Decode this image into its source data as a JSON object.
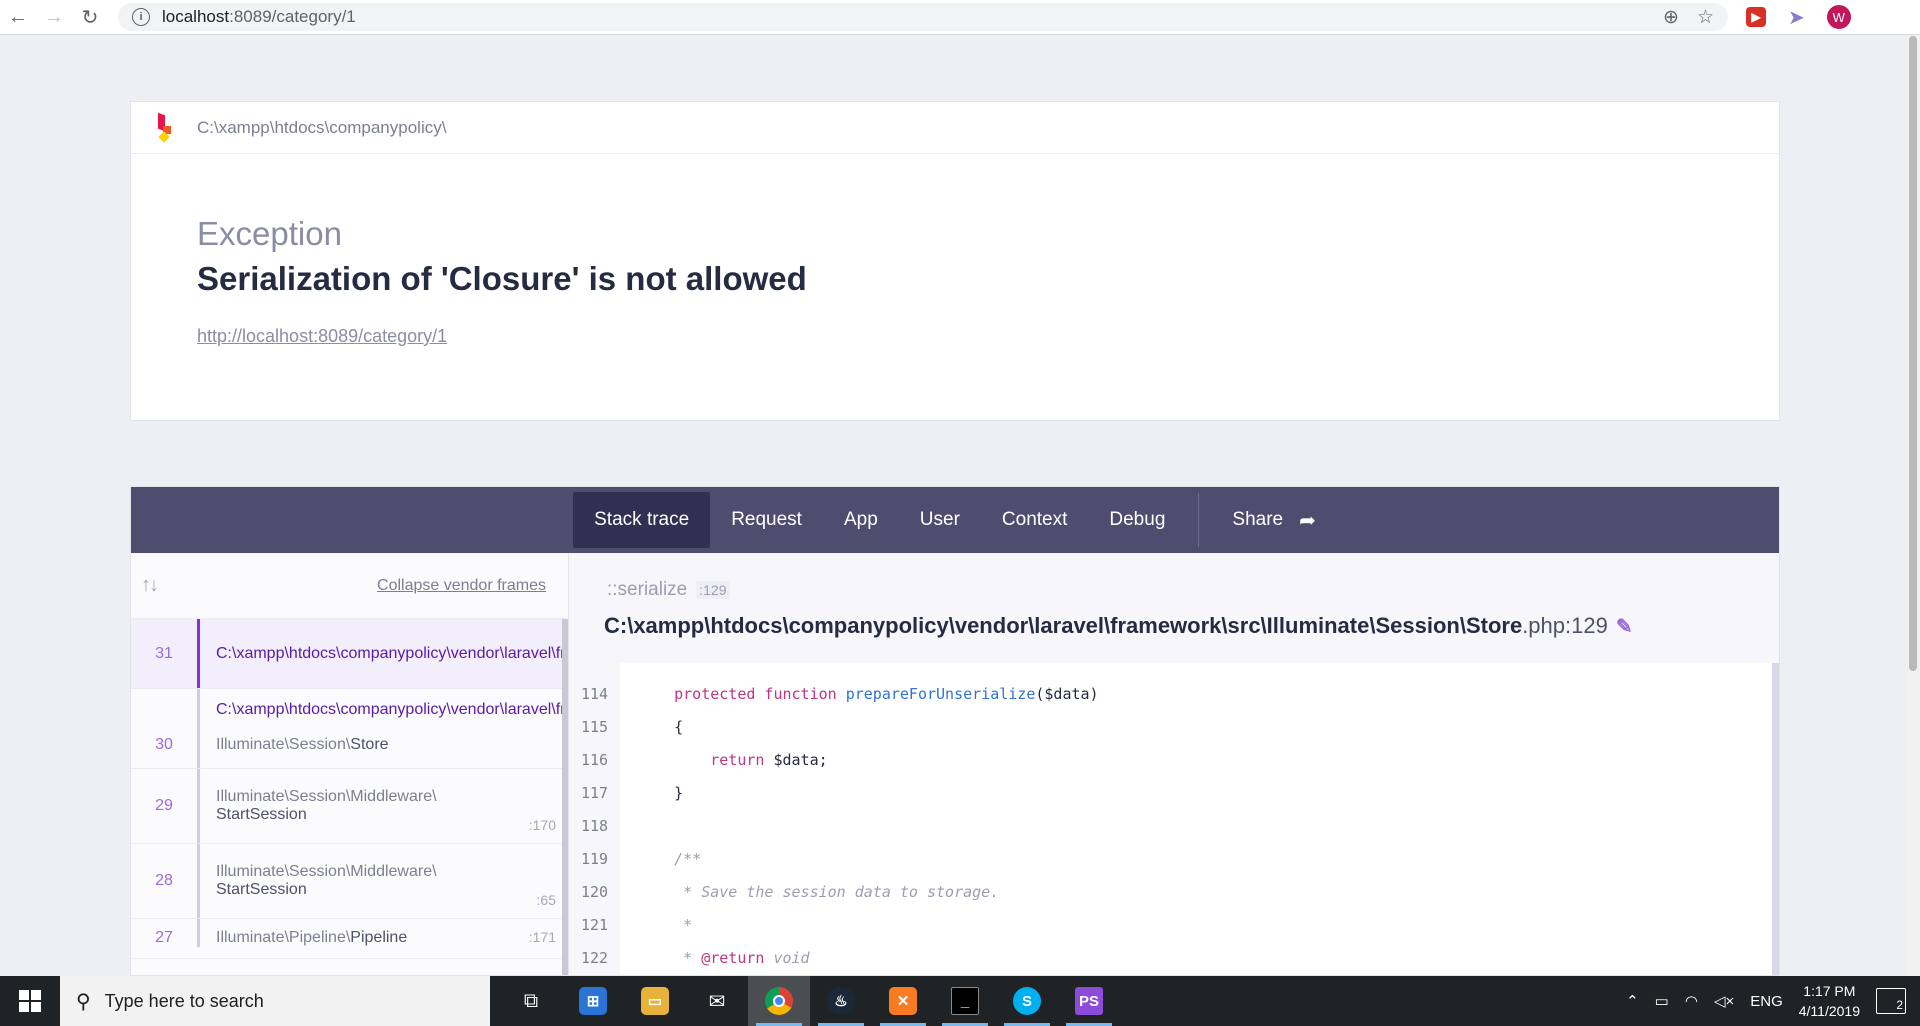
{
  "browser": {
    "url_host": "localhost",
    "url_rest": ":8089/category/1",
    "avatar_letter": "W",
    "extension_label": "▶"
  },
  "header": {
    "path": "C:\\xampp\\htdocs\\companypolicy\\"
  },
  "exception": {
    "type": "Exception",
    "message": "Serialization of 'Closure' is not allowed",
    "url": "http://localhost:8089/category/1"
  },
  "tabs": {
    "items": [
      "Stack trace",
      "Request",
      "App",
      "User",
      "Context",
      "Debug"
    ],
    "share": "Share"
  },
  "frames": {
    "collapse_label": "Collapse vendor frames",
    "items": [
      {
        "num": "31",
        "file": "C:\\xampp\\htdocs\\companypolicy\\vendor\\laravel\\framework\\src\\Illuminate\\Session\\Store.php"
      },
      {
        "num": "30",
        "file": "C:\\xampp\\htdocs\\companypolicy\\vendor\\laravel\\framework\\src\\Illuminate\\Session\\Store.php",
        "ns": "Illuminate\\Session\\",
        "cls": "Store"
      },
      {
        "num": "29",
        "ns": "Illuminate\\Session\\Middleware\\",
        "cls": "StartSession",
        "line": ":170"
      },
      {
        "num": "28",
        "ns": "Illuminate\\Session\\Middleware\\",
        "cls": "StartSession",
        "line": ":65"
      },
      {
        "num": "27",
        "ns": "Illuminate\\Pipeline\\",
        "cls": "Pipeline",
        "line": ":171"
      }
    ]
  },
  "code": {
    "function": "::serialize",
    "function_line": ":129",
    "file": "C:\\xampp\\htdocs\\companypolicy\\vendor\\laravel\\framework\\src\\Illuminate\\Session\\Store",
    "file_suffix": ".php:129",
    "line_numbers": [
      "114",
      "115",
      "116",
      "117",
      "118",
      "119",
      "120",
      "121",
      "122"
    ],
    "lines": {
      "l114_kw": "protected function ",
      "l114_fn": "prepareForUnserialize",
      "l114_rest": "($data)",
      "l115": "{",
      "l116_kw": "return",
      "l116_rest": " $data;",
      "l117": "}",
      "l119": "/**",
      "l120": " * Save the session data to storage.",
      "l121": " *",
      "l122_pre": " * ",
      "l122_tag": "@return",
      "l122_rest": " void"
    }
  },
  "taskbar": {
    "search_placeholder": "Type here to search",
    "language": "ENG",
    "time": "1:17 PM",
    "date": "4/11/2019",
    "notifications": "2"
  }
}
